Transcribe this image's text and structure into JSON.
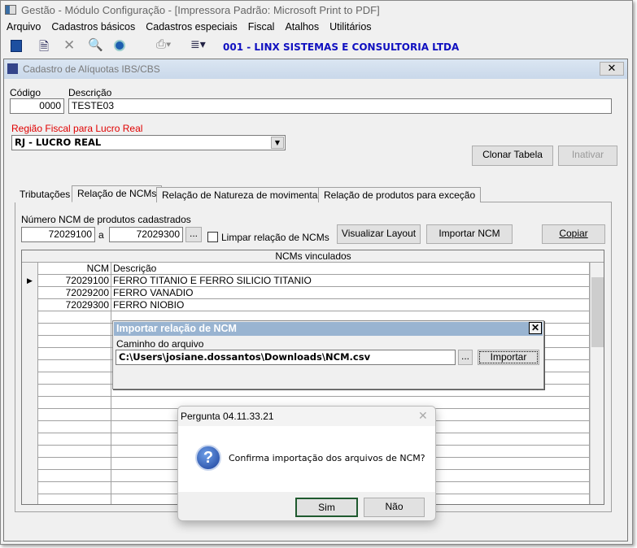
{
  "app": {
    "title": "Gestão  - Módulo Configuração - [Impressora Padrão: Microsoft Print to PDF]",
    "menu": [
      "Arquivo",
      "Cadastros básicos",
      "Cadastros especiais",
      "Fiscal",
      "Atalhos",
      "Utilitários"
    ],
    "company": "001 - LINX SISTEMAS E CONSULTORIA LTDA"
  },
  "form": {
    "title": "Cadastro de Alíquotas IBS/CBS",
    "codigo_label": "Código",
    "codigo": "0000",
    "descricao_label": "Descrição",
    "descricao": "TESTE03",
    "regiao_label": "Região Fiscal para Lucro Real",
    "regiao": "RJ - LUCRO REAL",
    "clonar": "Clonar Tabela",
    "inativar": "Inativar",
    "tabs": [
      "Tributações",
      "Relação de NCMs",
      "Relação de Natureza de movimentação",
      "Relação de produtos para exceção"
    ],
    "ncm_label": "Número  NCM de produtos cadastrados",
    "ncm_from": "72029100",
    "a": "a",
    "ncm_to": "72029300",
    "ellipsis": "...",
    "limpar": "Limpar relação de NCMs",
    "visualizar": "Visualizar Layout",
    "importar_ncm": "Importar NCM",
    "copiar": "Copiar",
    "grid": {
      "title": "NCMs vinculados",
      "headers": [
        "NCM",
        "Descrição"
      ],
      "rows": [
        [
          "72029100",
          "FERRO TITANIO E FERRO SILICIO TITANIO"
        ],
        [
          "72029200",
          "FERRO VANADIO"
        ],
        [
          "72029300",
          "FERRO NIOBIO"
        ]
      ]
    }
  },
  "import_dialog": {
    "title": "Importar relação de NCM",
    "label": "Caminho do arquivo",
    "path": "C:\\Users\\josiane.dossantos\\Downloads\\NCM.csv",
    "ellipsis": "...",
    "button": "Importar"
  },
  "question": {
    "title": "Pergunta 04.11.33.21",
    "message": "Confirma importação dos arquivos de NCM?",
    "yes": "Sim",
    "no": "Não",
    "icon": "question-icon"
  }
}
